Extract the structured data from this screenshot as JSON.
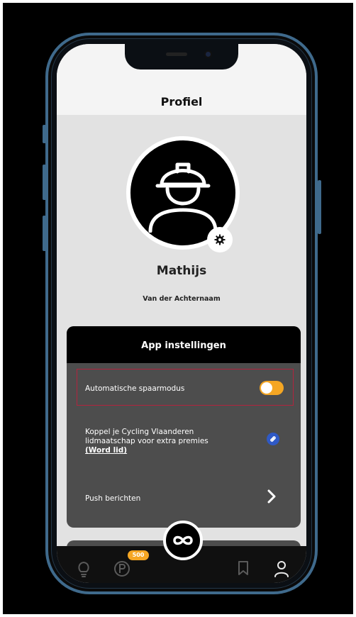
{
  "page": {
    "title": "Profiel"
  },
  "profile": {
    "first_name": "Mathijs",
    "last_name": "Van der Achternaam",
    "avatar_icon": "worker-helmet-icon",
    "settings_icon": "gear-icon"
  },
  "settings": {
    "header": "App instellingen",
    "rows": [
      {
        "label": "Automatische spaarmodus",
        "control": "toggle",
        "toggle_on": true
      },
      {
        "label": "Koppel je Cycling Vlaanderen lidmaatschap voor extra premies",
        "link_text": "(Word lid)",
        "control": "link-icon"
      },
      {
        "label": "Push berichten",
        "control": "chevron-right-icon"
      }
    ]
  },
  "tabbar": {
    "points_badge": "500",
    "items": [
      "lightbulb-icon",
      "points-icon",
      "loop-icon",
      "bookmark-icon",
      "user-icon"
    ]
  },
  "colors": {
    "accent": "#f5a623",
    "highlight": "#b3243e",
    "card": "#4d4d4d",
    "frame": "#3f6a8c"
  }
}
